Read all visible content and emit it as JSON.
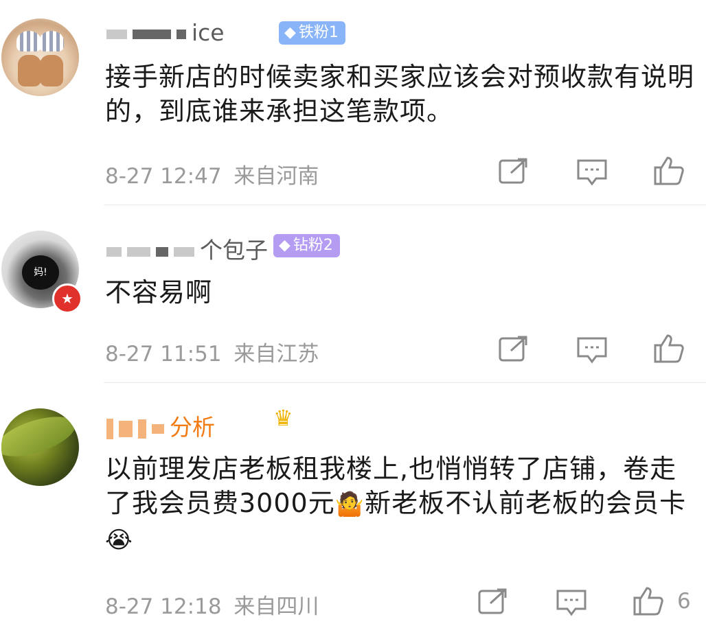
{
  "comments": [
    {
      "username_suffix": "ice",
      "badge_label": "铁粉1",
      "text": "接手新店的时候卖家和买家应该会对预收款有说明的，到底谁来承担这笔款项。",
      "time": "8-27 12:47",
      "location": "来自河南",
      "like_count": ""
    },
    {
      "username_suffix": "个包子",
      "badge_label": "钻粉2",
      "avatar_text": "妈!",
      "text": "不容易啊",
      "time": "8-27 11:51",
      "location": "来自江苏",
      "like_count": ""
    },
    {
      "username_suffix": "分析",
      "text_parts": [
        "以前理发店老板租我楼上,也悄悄转了店铺，卷走了我会员费3000元",
        "新老板不认前老板的会员卡",
        ""
      ],
      "time": "8-27 12:18",
      "location": "来自四川",
      "like_count": "6"
    }
  ],
  "icons": {
    "forward": "share-icon",
    "comment": "comment-icon",
    "like": "thumbs-up-icon"
  },
  "colors": {
    "badge_blue": "#8ab4f8",
    "badge_purple": "#b49cf2",
    "username_orange": "#f27a10",
    "meta_gray": "#9a9a9a"
  }
}
